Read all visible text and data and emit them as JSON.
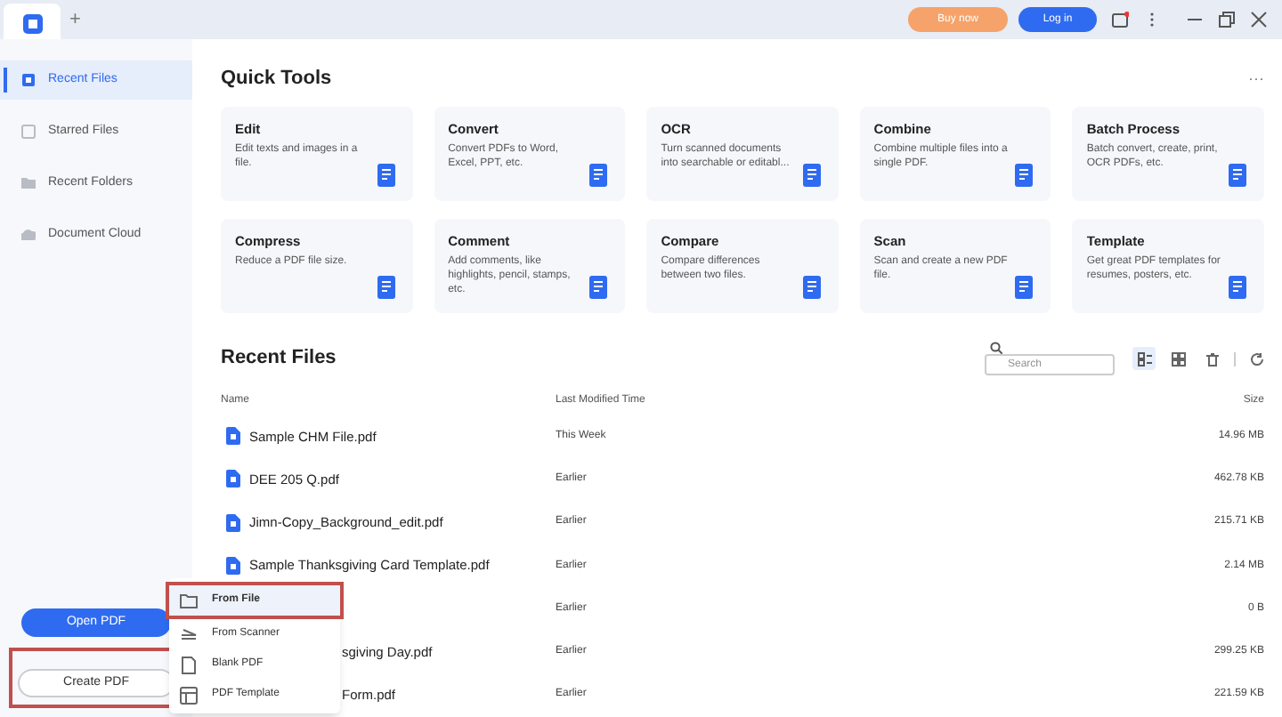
{
  "title_bar": {
    "new_tab": "+",
    "buy_button": "Buy now",
    "login_button": "Log in"
  },
  "sidebar": {
    "items": [
      {
        "label": "Recent Files",
        "selected": true
      },
      {
        "label": "Starred Files",
        "selected": false
      },
      {
        "label": "Recent Folders",
        "selected": false
      },
      {
        "label": "Document Cloud",
        "selected": false
      }
    ],
    "open_button": "Open PDF",
    "create_button": {
      "label": "Create PDF",
      "highlighted": true
    }
  },
  "quick_tools": {
    "title": "Quick Tools",
    "more": "···",
    "tools": [
      {
        "title": "Edit",
        "description": "Edit texts and images in a file."
      },
      {
        "title": "Convert",
        "description": "Convert PDFs to Word, Excel, PPT, etc."
      },
      {
        "title": "OCR",
        "description": "Turn scanned documents into searchable or editabl..."
      },
      {
        "title": "Combine",
        "description": "Combine multiple files into a single PDF."
      },
      {
        "title": "Batch Process",
        "description": "Batch convert, create, print, OCR PDFs, etc."
      },
      {
        "title": "Compress",
        "description": "Reduce a PDF file size."
      },
      {
        "title": "Comment",
        "description": "Add comments, like highlights, pencil, stamps, etc."
      },
      {
        "title": "Compare",
        "description": "Compare differences between two files."
      },
      {
        "title": "Scan",
        "description": "Scan and create a new PDF file."
      },
      {
        "title": "Template",
        "description": "Get great PDF templates for resumes, posters, etc."
      }
    ]
  },
  "recent_files": {
    "title": "Recent Files",
    "search": {
      "placeholder": "Search"
    },
    "columns": [
      "Name",
      "Last Modified Time",
      "Size"
    ],
    "rows": [
      {
        "name": "Sample CHM File.pdf",
        "modified": "This Week",
        "size": "14.96 MB"
      },
      {
        "name": "DEE 205 Q.pdf",
        "modified": "Earlier",
        "size": "462.78 KB"
      },
      {
        "name": "Jimn-Copy_Background_edit.pdf",
        "modified": "Earlier",
        "size": "215.71 KB"
      },
      {
        "name": "Sample Thanksgiving Card Template.pdf",
        "modified": "Earlier",
        "size": "2.14 MB"
      },
      {
        "modified": "Earlier",
        "size": "0 B"
      },
      {
        "name": "sgiving Day.pdf",
        "kind": "partial",
        "modified": "Earlier",
        "size": "299.25 KB"
      },
      {
        "name": "Form.pdf",
        "kind": "partial",
        "modified": "Earlier",
        "size": "221.59 KB"
      }
    ]
  },
  "create_menu": {
    "items": [
      {
        "label": "From File",
        "highlighted": true
      },
      {
        "label": "From Scanner",
        "highlighted": false
      },
      {
        "label": "Blank PDF",
        "highlighted": false
      },
      {
        "label": "PDF Template",
        "highlighted": false
      }
    ]
  }
}
